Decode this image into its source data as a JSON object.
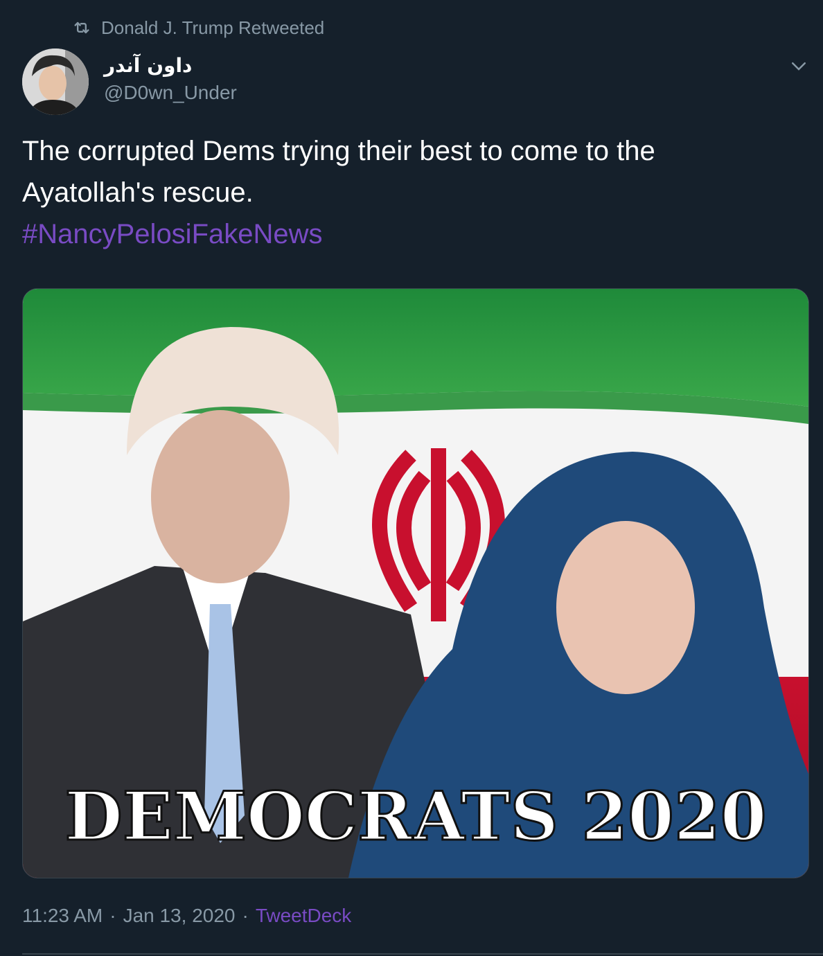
{
  "retweet": {
    "label": "Donald J. Trump Retweeted",
    "icon": "retweet-icon"
  },
  "author": {
    "display_name": "داون آندر",
    "handle": "@D0wn_Under"
  },
  "tweet": {
    "text": "The corrupted Dems trying their best to come to the Ayatollah's rescue.",
    "hashtag": "#NancyPelosiFakeNews"
  },
  "media": {
    "caption": "DEMOCRATS 2020"
  },
  "meta": {
    "time": "11:23 AM",
    "separator": "·",
    "date": "Jan 13, 2020",
    "source": "TweetDeck"
  },
  "colors": {
    "background": "#15202b",
    "secondary_text": "#8899a6",
    "link": "#794bc4"
  },
  "icons": {
    "menu": "chevron-down-icon"
  }
}
